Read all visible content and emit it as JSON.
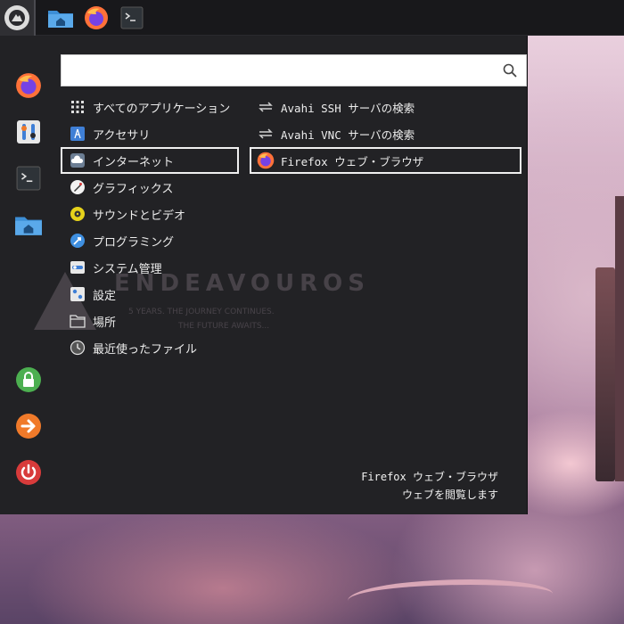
{
  "taskbar": {
    "launchers": [
      {
        "icon": "endeavouros-logo-icon"
      },
      {
        "icon": "home-folder-icon"
      },
      {
        "icon": "firefox-icon"
      },
      {
        "icon": "terminal-icon"
      }
    ]
  },
  "favorites": [
    {
      "icon": "firefox-icon"
    },
    {
      "icon": "settings-icon"
    },
    {
      "icon": "terminal-icon"
    },
    {
      "icon": "home-folder-icon"
    },
    {
      "icon": "lock-icon"
    },
    {
      "icon": "logout-icon"
    },
    {
      "icon": "power-icon"
    }
  ],
  "search": {
    "placeholder": "",
    "value": ""
  },
  "categories": [
    {
      "label": "すべてのアプリケーション",
      "icon": "grid-icon"
    },
    {
      "label": "アクセサリ",
      "icon": "accessories-icon"
    },
    {
      "label": "インターネット",
      "icon": "cloud-icon",
      "selected": true
    },
    {
      "label": "グラフィックス",
      "icon": "graphics-icon"
    },
    {
      "label": "サウンドとビデオ",
      "icon": "multimedia-icon"
    },
    {
      "label": "プログラミング",
      "icon": "development-icon"
    },
    {
      "label": "システム管理",
      "icon": "system-icon"
    },
    {
      "label": "設定",
      "icon": "settings-icon"
    },
    {
      "label": "場所",
      "icon": "folder-icon"
    },
    {
      "label": "最近使ったファイル",
      "icon": "recent-icon"
    }
  ],
  "apps": [
    {
      "label": "Avahi SSH サーバの検索",
      "icon": "network-arrows-icon"
    },
    {
      "label": "Avahi VNC サーバの検索",
      "icon": "network-arrows-icon"
    },
    {
      "label": "Firefox ウェブ・ブラウザ",
      "icon": "firefox-icon",
      "selected": true
    }
  ],
  "watermark": {
    "title": "ENDEAVOUROS",
    "line1": "5 YEARS. THE JOURNEY CONTINUES.",
    "line2": "THE FUTURE AWAITS..."
  },
  "description": {
    "title": "Firefox ウェブ・ブラウザ",
    "text": "ウェブを閲覧します"
  },
  "colors": {
    "panel_bg": "#222225",
    "taskbar_bg": "#18181b",
    "selection_border": "#f0f0f0",
    "lock_green": "#4caf50",
    "logout_orange": "#f07a2a",
    "power_red": "#d83b3b"
  }
}
